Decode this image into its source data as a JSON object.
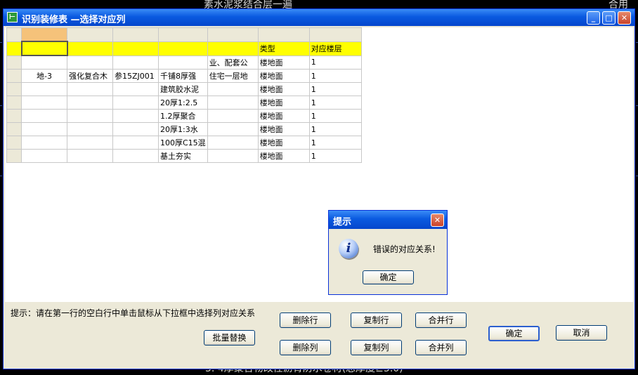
{
  "background": {
    "top_text": "素水泥浆结合层一遍",
    "right_text": "合用",
    "bottom_text": "5. 4厚聚合物改性沥青防水卷材(总厚度≥5.0)"
  },
  "window": {
    "title": "识别装修表 —选择对应列",
    "icon_glyph": "⊢",
    "min_glyph": "_",
    "max_glyph": "□",
    "close_glyph": "✕"
  },
  "grid": {
    "header_row": [
      "",
      "",
      "",
      "",
      "",
      "",
      "",
      ""
    ],
    "yellow_row": [
      "",
      "",
      "",
      "",
      "",
      "",
      "类型",
      "对应楼层"
    ],
    "rows": [
      [
        "",
        "",
        "",
        "",
        "",
        "业、配套公",
        "楼地面",
        "1"
      ],
      [
        "",
        "地-3",
        "强化复合木",
        "参15ZJ001",
        "千铺8厚强",
        "住宅一层地",
        "楼地面",
        "1"
      ],
      [
        "",
        "",
        "",
        "",
        "建筑胶水泥",
        "",
        "楼地面",
        "1"
      ],
      [
        "",
        "",
        "",
        "",
        "20厚1:2.5",
        "",
        "楼地面",
        "1"
      ],
      [
        "",
        "",
        "",
        "",
        "1.2厚聚合",
        "",
        "楼地面",
        "1"
      ],
      [
        "",
        "",
        "",
        "",
        "20厚1:3水",
        "",
        "楼地面",
        "1"
      ],
      [
        "",
        "",
        "",
        "",
        "100厚C15混",
        "",
        "楼地面",
        "1"
      ],
      [
        "",
        "",
        "",
        "",
        "基土夯实",
        "",
        "楼地面",
        "1"
      ]
    ]
  },
  "panel": {
    "hint": "提示：请在第一行的空白行中单击鼠标从下拉框中选择列对应关系",
    "buttons": {
      "batch_replace": "批量替换",
      "delete_row": "删除行",
      "delete_col": "删除列",
      "copy_row": "复制行",
      "copy_col": "复制列",
      "merge_row": "合并行",
      "merge_col": "合并列",
      "ok": "确定",
      "cancel": "取消"
    }
  },
  "dialog": {
    "title": "提示",
    "message": "错误的对应关系!",
    "ok": "确定",
    "icon_glyph": "i",
    "close_glyph": "✕"
  },
  "colors": {
    "titlebar": "#0a5ae0",
    "highlight_row": "#ffff00",
    "selected_header": "#f5c27a"
  }
}
